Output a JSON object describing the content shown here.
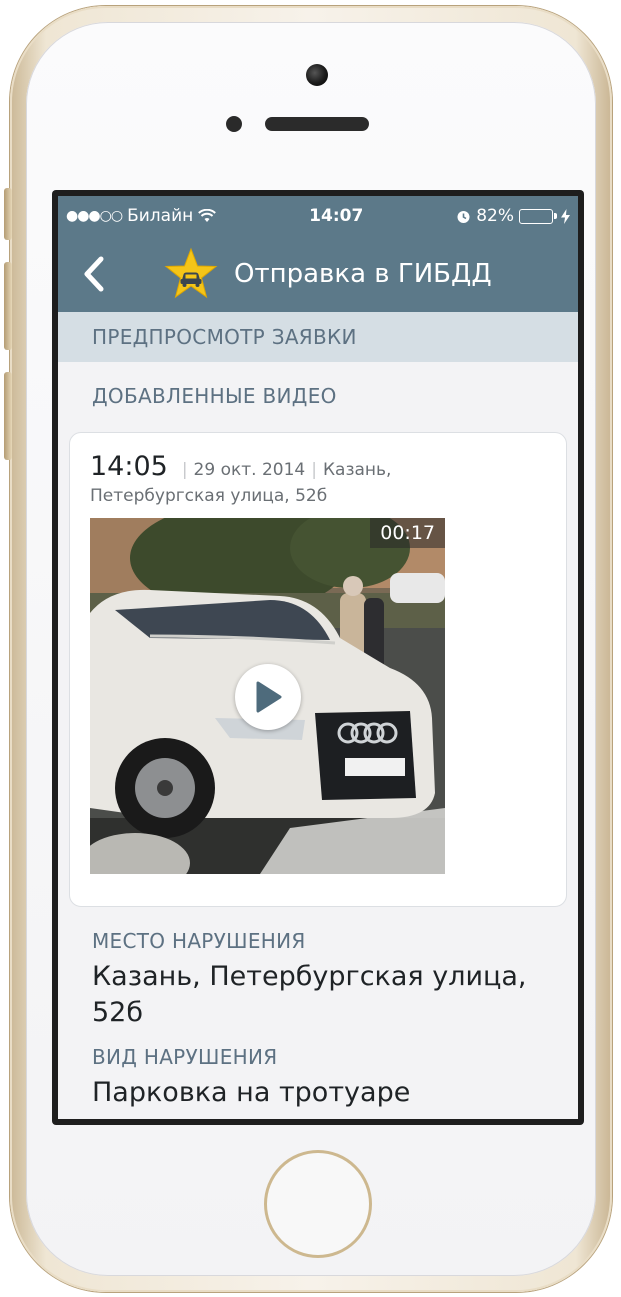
{
  "statusbar": {
    "signal": "●●●○○",
    "carrier": "Билайн",
    "time": "14:07",
    "battery_percent": "82%",
    "battery_level": 0.82
  },
  "navbar": {
    "title": "Отправка в ГИБДД",
    "back_icon": "chevron-left-icon",
    "logo_icon": "star-car-icon"
  },
  "section_header": "ПРЕДПРОСМОТР ЗАЯВКИ",
  "videos_label": "ДОБАВЛЕННЫЕ ВИДЕО",
  "video_card": {
    "time": "14:05",
    "date": "29 окт. 2014",
    "city": "Казань,",
    "street": "Петербургская улица, 52б",
    "duration": "00:17"
  },
  "violation_place": {
    "label": "МЕСТО НАРУШЕНИЯ",
    "value": "Казань, Петербургская улица, 52б"
  },
  "violation_type": {
    "label": "ВИД НАРУШЕНИЯ",
    "value": "Парковка на тротуаре"
  },
  "colors": {
    "header": "#5c7989",
    "section_bar": "#d5dee4",
    "label": "#5d7182",
    "star": "#f5c518",
    "play_icon": "#4e6b7c"
  }
}
